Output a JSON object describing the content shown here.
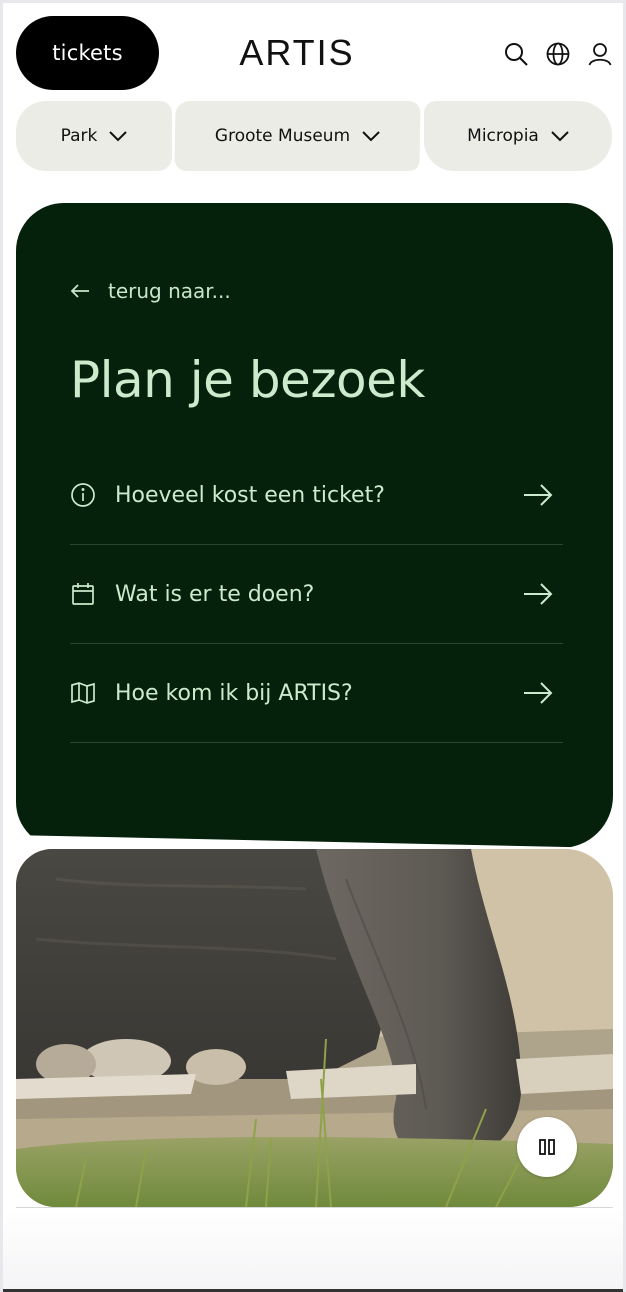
{
  "header": {
    "tickets_label": "tickets",
    "logo_text": "ARTIS",
    "icons": [
      "search-icon",
      "globe-icon",
      "user-icon"
    ]
  },
  "categories": [
    {
      "label": "Park"
    },
    {
      "label": "Groote Museum"
    },
    {
      "label": "Micropia"
    }
  ],
  "panel": {
    "back_label": "terug naar...",
    "title": "Plan je bezoek",
    "links": [
      {
        "label": "Hoeveel kost een ticket?",
        "icon": "info-icon"
      },
      {
        "label": "Wat is er te doen?",
        "icon": "calendar-icon"
      },
      {
        "label": "Hoe kom ik bij ARTIS?",
        "icon": "map-icon"
      }
    ],
    "colors": {
      "background": "#05200b",
      "text": "#cdeacd"
    }
  },
  "media": {
    "image_subject": "elephant feet and trunk on sandy ground with grass",
    "pause_icon": "pause-icon"
  }
}
